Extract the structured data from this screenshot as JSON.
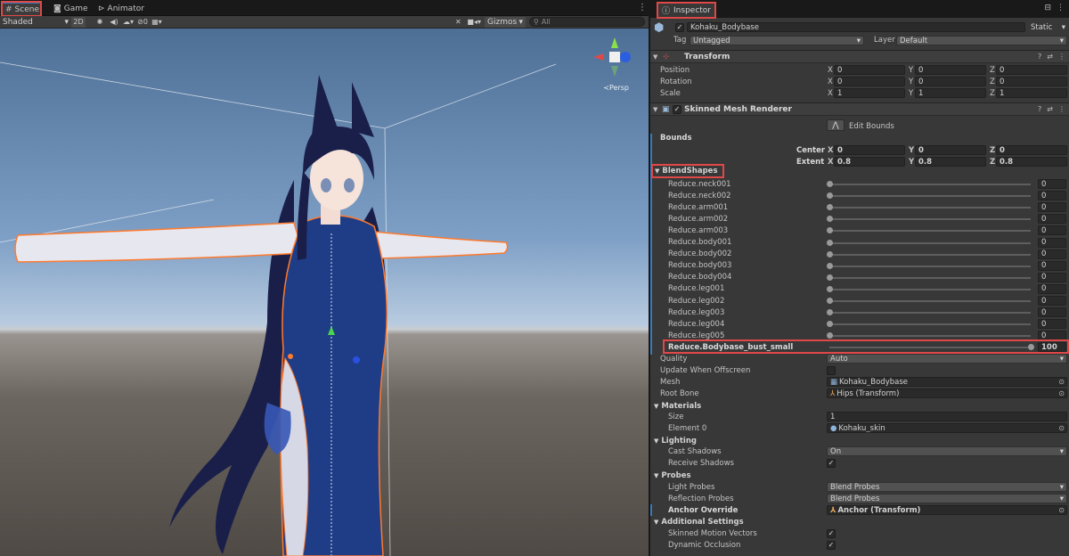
{
  "scene_tabs": [
    {
      "label": "Scene",
      "icon": "grid-icon"
    },
    {
      "label": "Game",
      "icon": "gamepad-icon"
    },
    {
      "label": "Animator",
      "icon": "animator-icon"
    }
  ],
  "scene_toolbar": {
    "shading": "Shaded",
    "mode_2d": "2D",
    "hidden_count": "0",
    "gizmos": "Gizmos",
    "search_placeholder": "All"
  },
  "viewport": {
    "camera_label": "≺Persp"
  },
  "inspector": {
    "tab_label": "Inspector",
    "object_name": "Kohaku_Bodybase",
    "static_label": "Static",
    "tag_label": "Tag",
    "tag_value": "Untagged",
    "layer_label": "Layer",
    "layer_value": "Default",
    "transform": {
      "title": "Transform",
      "rows": [
        {
          "label": "Position",
          "x": "0",
          "y": "0",
          "z": "0"
        },
        {
          "label": "Rotation",
          "x": "0",
          "y": "0",
          "z": "0"
        },
        {
          "label": "Scale",
          "x": "1",
          "y": "1",
          "z": "1"
        }
      ]
    },
    "smr": {
      "title": "Skinned Mesh Renderer",
      "edit_bounds": "Edit Bounds",
      "bounds_label": "Bounds",
      "center_label": "Center",
      "center": {
        "x": "0",
        "y": "0",
        "z": "0"
      },
      "extent_label": "Extent",
      "extent": {
        "x": "0.8",
        "y": "0.8",
        "z": "0.8"
      },
      "blendshapes_label": "BlendShapes",
      "blendshapes": [
        {
          "name": "Reduce.neck001",
          "value": 0
        },
        {
          "name": "Reduce.neck002",
          "value": 0
        },
        {
          "name": "Reduce.arm001",
          "value": 0
        },
        {
          "name": "Reduce.arm002",
          "value": 0
        },
        {
          "name": "Reduce.arm003",
          "value": 0
        },
        {
          "name": "Reduce.body001",
          "value": 0
        },
        {
          "name": "Reduce.body002",
          "value": 0
        },
        {
          "name": "Reduce.body003",
          "value": 0
        },
        {
          "name": "Reduce.body004",
          "value": 0
        },
        {
          "name": "Reduce.leg001",
          "value": 0
        },
        {
          "name": "Reduce.leg002",
          "value": 0
        },
        {
          "name": "Reduce.leg003",
          "value": 0
        },
        {
          "name": "Reduce.leg004",
          "value": 0
        },
        {
          "name": "Reduce.leg005",
          "value": 0
        },
        {
          "name": "Reduce.Bodybase_bust_small",
          "value": 100
        }
      ],
      "quality_label": "Quality",
      "quality_value": "Auto",
      "update_offscreen_label": "Update When Offscreen",
      "mesh_label": "Mesh",
      "mesh_value": "Kohaku_Bodybase",
      "rootbone_label": "Root Bone",
      "rootbone_value": "Hips (Transform)",
      "materials_label": "Materials",
      "size_label": "Size",
      "size_value": "1",
      "element0_label": "Element 0",
      "element0_value": "Kohaku_skin",
      "lighting_label": "Lighting",
      "cast_shadows_label": "Cast Shadows",
      "cast_shadows_value": "On",
      "receive_shadows_label": "Receive Shadows",
      "probes_label": "Probes",
      "light_probes_label": "Light Probes",
      "light_probes_value": "Blend Probes",
      "reflection_probes_label": "Reflection Probes",
      "reflection_probes_value": "Blend Probes",
      "anchor_override_label": "Anchor Override",
      "anchor_override_value": "Anchor (Transform)",
      "additional_label": "Additional Settings",
      "motion_vectors_label": "Skinned Motion Vectors",
      "dynamic_occlusion_label": "Dynamic Occlusion"
    }
  },
  "colors": {
    "accent_blue": "#3a79bb",
    "highlight_red": "#e04848",
    "selection_orange": "#ff7a2e",
    "outfit_navy": "#1f3d86",
    "hair": "#1a1f4a"
  }
}
